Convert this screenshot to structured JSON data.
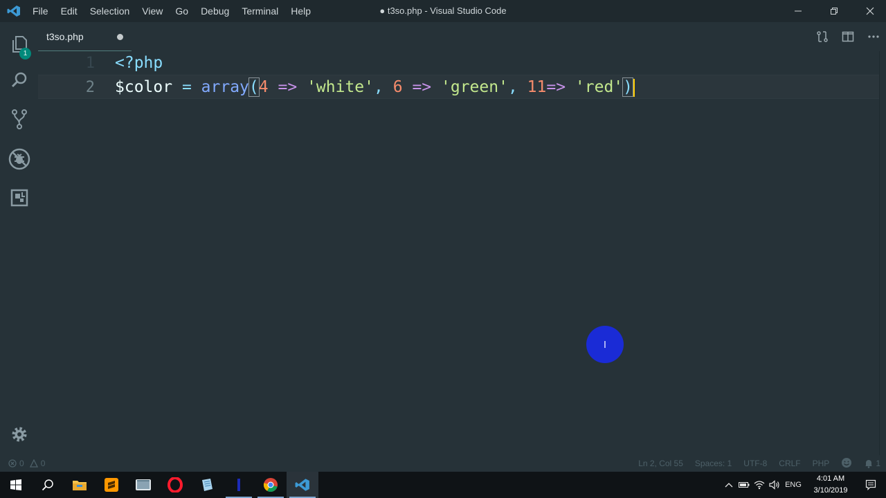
{
  "window": {
    "title": "● t3so.php - Visual Studio Code",
    "menu": [
      "File",
      "Edit",
      "Selection",
      "View",
      "Go",
      "Debug",
      "Terminal",
      "Help"
    ]
  },
  "activity_bar": {
    "items": [
      {
        "name": "explorer",
        "icon": "files-icon",
        "badge": "1"
      },
      {
        "name": "search",
        "icon": "search-icon"
      },
      {
        "name": "source-control",
        "icon": "git-branch-icon"
      },
      {
        "name": "debug",
        "icon": "bug-icon"
      },
      {
        "name": "extensions",
        "icon": "extensions-icon"
      }
    ],
    "manage_icon": "gear-icon"
  },
  "tabs": [
    {
      "label": "t3so.php",
      "modified": true
    }
  ],
  "editor": {
    "lines": [
      {
        "number": "1",
        "text": "<?php"
      },
      {
        "number": "2",
        "text": "$color = array(4 => 'white', 6 => 'green', 11=> 'red')"
      }
    ],
    "active_line": 2
  },
  "statusbar": {
    "errors": "0",
    "warnings": "0",
    "position": "Ln 2, Col 55",
    "spaces": "Spaces: 1",
    "encoding": "UTF-8",
    "eol": "CRLF",
    "language": "PHP",
    "notifications": "1"
  },
  "taskbar": {
    "language": "ENG",
    "time": "4:01 AM",
    "date": "3/10/2019"
  },
  "colors": {
    "editor_bg": "#263238",
    "accent": "#80cbc4",
    "cursor": "#ffcc00",
    "string": "#c3e88d",
    "number": "#f78c6c",
    "function": "#82aaff",
    "operator": "#89ddff"
  }
}
